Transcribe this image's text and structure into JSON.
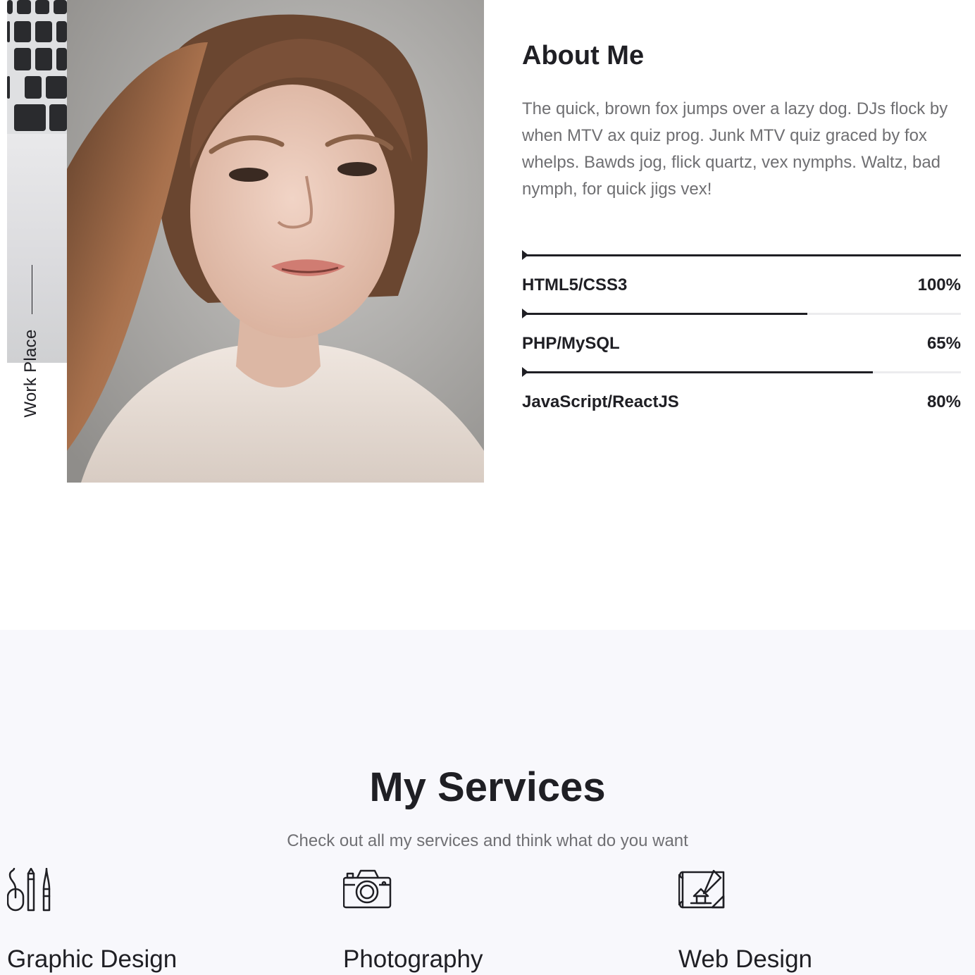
{
  "workplace": {
    "label": "Work Place"
  },
  "about": {
    "title": "About Me",
    "text": "The quick, brown fox jumps over a lazy dog. DJs flock by when MTV ax quiz prog. Junk MTV quiz graced by fox whelps. Bawds jog, flick quartz, vex nymphs. Waltz, bad nymph, for quick jigs vex!"
  },
  "skills": [
    {
      "name": "HTML5/CSS3",
      "percent_label": "100%",
      "value": 100
    },
    {
      "name": "PHP/MySQL",
      "percent_label": "65%",
      "value": 65
    },
    {
      "name": "JavaScript/ReactJS",
      "percent_label": "80%",
      "value": 80
    }
  ],
  "services": {
    "title": "My Services",
    "subtitle": "Check out all my services and think what do you want",
    "items": [
      {
        "name": "Graphic Design",
        "icon": "design-tools-icon"
      },
      {
        "name": "Photography",
        "icon": "camera-icon"
      },
      {
        "name": "Web Design",
        "icon": "blueprint-icon"
      }
    ]
  },
  "colors": {
    "text_dark": "#1f1f24",
    "text_muted": "#6f6f72",
    "services_bg": "#f8f8fc"
  }
}
